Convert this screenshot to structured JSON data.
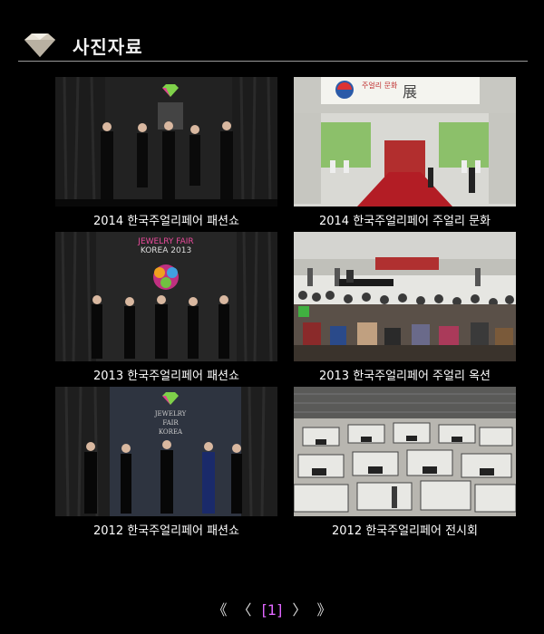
{
  "header": {
    "title": "사진자료",
    "icon": "diamond-icon",
    "accent": "#d8d0c0"
  },
  "gallery": {
    "items": [
      {
        "caption": "2014 한국주얼리페어 패션쇼",
        "image": "fashion-show-2014"
      },
      {
        "caption": "2014 한국주얼리페어 주얼리 문화",
        "image": "exhibition-hall-2014",
        "sign_text": "주얼리 문화",
        "sign_char": "展"
      },
      {
        "caption": "2013 한국주얼리페어 패션쇼",
        "image": "fashion-show-2013",
        "backdrop_text": "JEWELRY FAIR",
        "backdrop_text2": "KOREA 2013"
      },
      {
        "caption": "2013 한국주얼리페어 주얼리 옥션",
        "image": "auction-audience-2013"
      },
      {
        "caption": "2012 한국주얼리페어 패션쇼",
        "image": "fashion-show-2012",
        "backdrop_text": "JEWELRY",
        "backdrop_text2": "FAIR",
        "backdrop_text3": "KOREA"
      },
      {
        "caption": "2012 한국주얼리페어 전시회",
        "image": "exhibition-floor-2012"
      }
    ]
  },
  "pagination": {
    "first": "《",
    "prev": "〈",
    "current": "[1]",
    "next": "〉",
    "last": "》",
    "current_color": "#e066ff"
  }
}
